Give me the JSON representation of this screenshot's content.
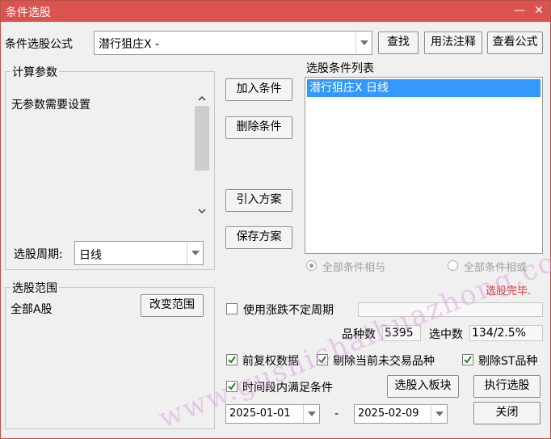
{
  "window": {
    "title": "条件选股",
    "minimize_glyph": "—",
    "close_glyph": "✕"
  },
  "formula": {
    "label": "条件选股公式",
    "value": "潜行狙庄X  -",
    "find_button": "查找",
    "usage_button": "用法注释",
    "view_button": "查看公式"
  },
  "params": {
    "group_label": "计算参数",
    "text": "无参数需要设置",
    "period_label": "选股周期:",
    "period_value": "日线"
  },
  "actions": {
    "add": "加入条件",
    "delete": "删除条件",
    "import": "引入方案",
    "save": "保存方案"
  },
  "conditions": {
    "label": "选股条件列表",
    "items": [
      "潜行狙庄X  日线"
    ],
    "radio_and": "全部条件相与",
    "radio_or": "全部条件相或"
  },
  "status": {
    "text": "选股完毕.",
    "color": "#e03030"
  },
  "range": {
    "group_label": "选股范围",
    "value": "全部A股",
    "change_button": "改变范围"
  },
  "options": {
    "variable_period": {
      "label": "使用涨跌不定周期",
      "checked": false
    },
    "stock_count_label": "品种数",
    "stock_count": "5395",
    "selected_label": "选中数",
    "selected_value": "134/2.5%",
    "adjusted": {
      "label": "前复权数据",
      "checked": true
    },
    "exclude_untraded": {
      "label": "剔除当前未交易品种",
      "checked": true
    },
    "exclude_st": {
      "label": "剔除ST品种",
      "checked": true
    },
    "time_range": {
      "label": "时间段内满足条件",
      "checked": true
    }
  },
  "buttons": {
    "to_block": "选股入板块",
    "execute": "执行选股",
    "close": "关闭"
  },
  "dates": {
    "start": "2025-01-01",
    "separator": "-",
    "end": "2025-02-09"
  },
  "watermark": "www.gushichaihuazhong.com",
  "icons": [
    "minimize-icon",
    "close-icon",
    "chevron-down-icon",
    "scroll-up-icon",
    "scroll-down-icon",
    "checkmark-icon"
  ]
}
